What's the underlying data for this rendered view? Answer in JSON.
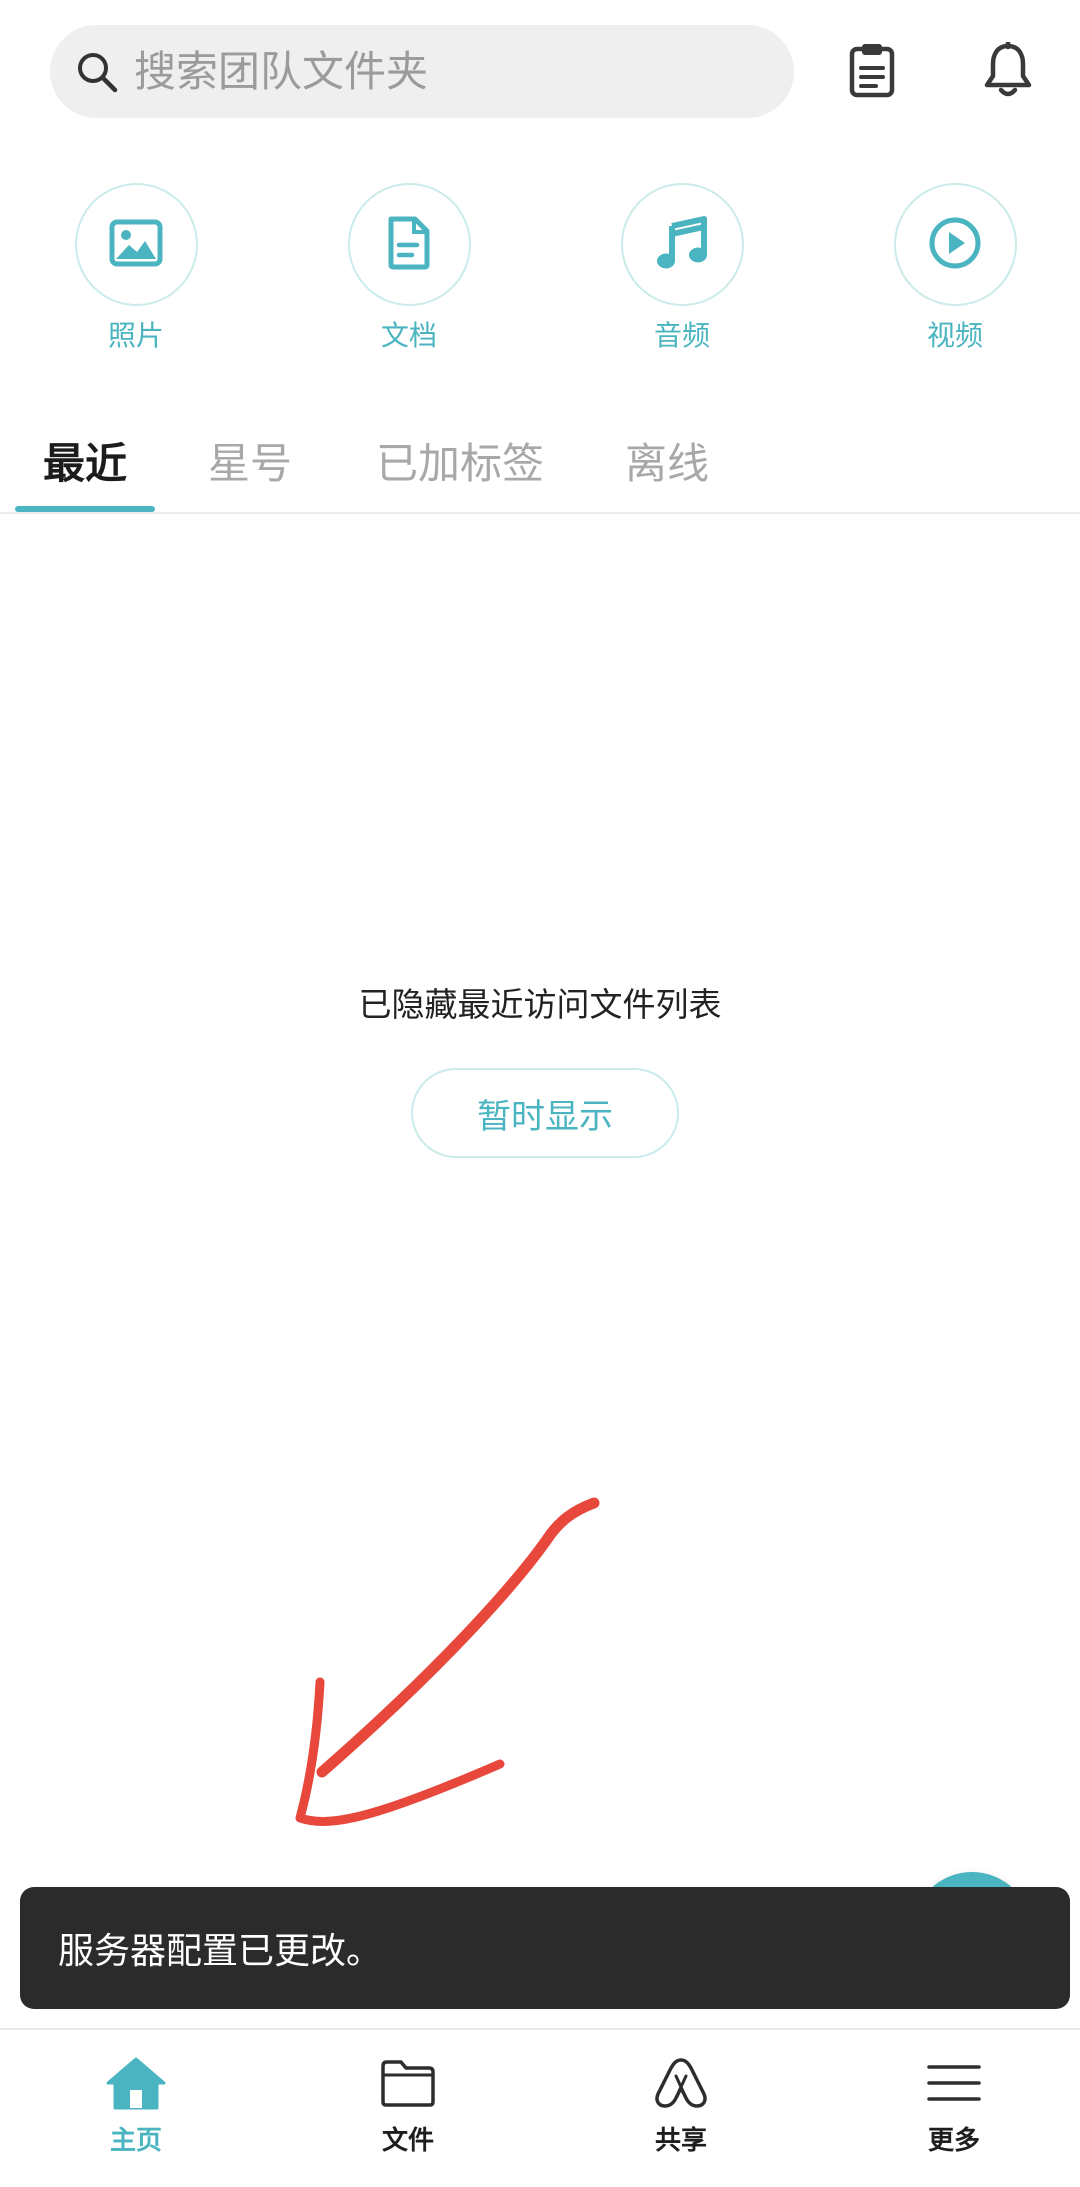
{
  "search": {
    "placeholder": "搜索团队文件夹",
    "icon": "search-icon"
  },
  "header_icons": [
    "clipboard-icon",
    "bell-icon"
  ],
  "categories": [
    {
      "label": "照片",
      "icon": "image-icon"
    },
    {
      "label": "文档",
      "icon": "document-icon"
    },
    {
      "label": "音频",
      "icon": "music-icon"
    },
    {
      "label": "视频",
      "icon": "play-icon"
    }
  ],
  "tabs": [
    {
      "label": "最近",
      "active": true
    },
    {
      "label": "星号",
      "active": false
    },
    {
      "label": "已加标签",
      "active": false
    },
    {
      "label": "离线",
      "active": false
    }
  ],
  "empty_state": {
    "message": "已隐藏最近访问文件列表",
    "button_label": "暂时显示"
  },
  "snackbar": {
    "message": "服务器配置已更改。"
  },
  "bottom_nav": [
    {
      "label": "主页",
      "icon": "home-icon",
      "active": true
    },
    {
      "label": "文件",
      "icon": "folder-icon",
      "active": false
    },
    {
      "label": "共享",
      "icon": "share-icon",
      "active": false
    },
    {
      "label": "更多",
      "icon": "menu-icon",
      "active": false
    }
  ],
  "colors": {
    "accent": "#4ab4c0",
    "accent_light": "#c9ebea",
    "snackbar_bg": "#2b2b2b",
    "annotation": "#e8473b"
  }
}
